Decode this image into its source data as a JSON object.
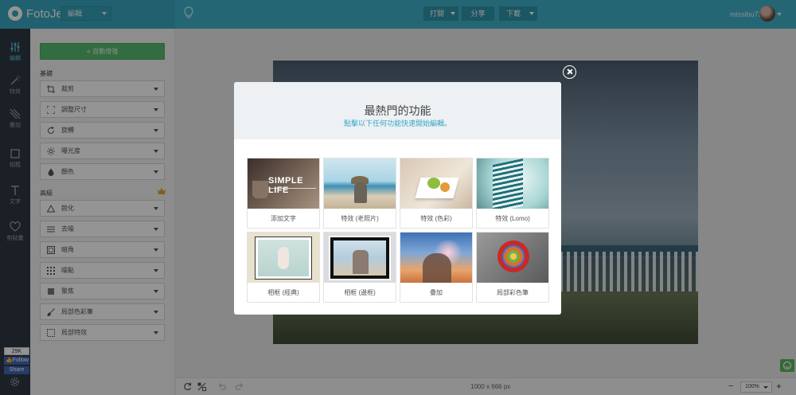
{
  "app": {
    "name": "FotoJet",
    "mode": "編輯"
  },
  "toolbar": {
    "open_label": "打開",
    "share_label": "分享",
    "download_label": "下載",
    "username": "missibu73"
  },
  "rail": [
    {
      "label": "編輯",
      "icon": "sliders-icon",
      "active": true
    },
    {
      "label": "特效",
      "icon": "magic-wand-icon",
      "active": false
    },
    {
      "label": "疊加",
      "icon": "layers-icon",
      "active": false
    },
    {
      "label": "相框",
      "icon": "frame-icon",
      "active": false
    },
    {
      "label": "文字",
      "icon": "text-icon",
      "active": false
    },
    {
      "label": "剪貼畫",
      "icon": "heart-icon",
      "active": false
    }
  ],
  "social": {
    "count": "29K",
    "follow_label": "Follow",
    "share_label": "Share"
  },
  "panel": {
    "auto_enhance_label": "自動增強",
    "basic_title": "基礎",
    "basic_tools": [
      "裁剪",
      "調整尺寸",
      "旋轉",
      "曝光度",
      "顏色"
    ],
    "advanced_title": "高級",
    "advanced_tools": [
      "銳化",
      "去噪",
      "暗角",
      "噪點",
      "聚焦",
      "局部色彩筆",
      "局部特效"
    ]
  },
  "canvas": {
    "dimensions": "1000 x 666 px",
    "zoom": "100%",
    "zoom_minus": "−",
    "zoom_plus": "+"
  },
  "modal": {
    "title": "最熱門的功能",
    "subtitle": "點擊以下任何功能快速開始編輯。",
    "features": [
      {
        "label": "添加文字",
        "thumb_text": "SIMPLE LIFE"
      },
      {
        "label": "特效 (老照片)"
      },
      {
        "label": "特效 (色彩)"
      },
      {
        "label": "特效 (Lomo)"
      },
      {
        "label": "相框 (經典)"
      },
      {
        "label": "相框 (邊框)"
      },
      {
        "label": "疊加"
      },
      {
        "label": "局部彩色筆"
      }
    ]
  },
  "colors": {
    "topbar": "#3fb0c9",
    "rail": "#2f3744",
    "accent_green": "#55bc6f",
    "link_blue": "#3aa6c6"
  }
}
